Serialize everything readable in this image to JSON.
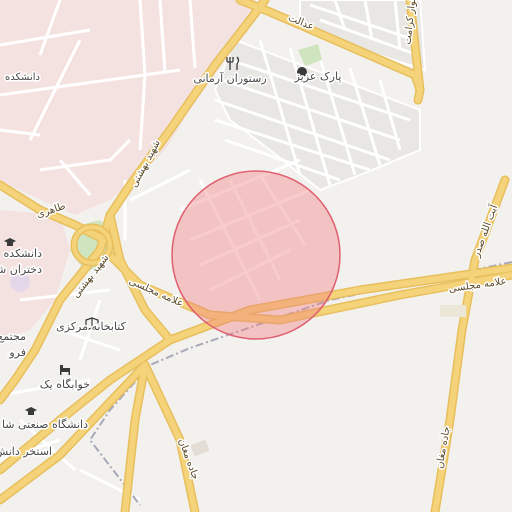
{
  "map": {
    "selection_circle": {
      "fill": "#f08080",
      "stroke": "#e06070"
    },
    "colors": {
      "background": "#f3f1ee",
      "campus": "#f4e2e0",
      "park": "#cfe5bf",
      "major_road": "#f5d37a",
      "major_road_edge": "#e7bf5c",
      "minor_road": "#ffffff",
      "block": "#e8e6e3",
      "railway": "#a8a8b8"
    },
    "labels": {
      "daneshkadeh_top": "دانشکده",
      "restaurant": "رستوران آرمانی",
      "park_aziz": "پارک عزیز",
      "edalat": "عدالت",
      "boulevard_right": "بلوار کرامت",
      "taheri": "طاهری",
      "shahid_beheshti_n": "شهید بهشتی",
      "shahid_beheshti_s": "شهید بهشتی",
      "allameh_majlesi": "علامه مجلسی",
      "majlesi_right": "علامه مجلسی",
      "ayatollah_sadr": "آیت الله صدر",
      "daneshkadeh_dokhtaran_1": "دانشکده",
      "daneshkadeh_dokhtaran_2": "دختران شا",
      "central_library": "کتابخانه مرکزی",
      "mojtama_1": "مجتمع",
      "mojtama_2": "فرو",
      "dormitory": "خوابگاه یک",
      "industrial_univ": "دانشگاه صنعتی شا",
      "pool": "استخر دانش",
      "jadeh_maghan_left": "جاده مغان",
      "jadeh_maghan_right": "جاده مغان"
    },
    "icons": {
      "restaurant": "fork-knife-icon",
      "park": "tree-icon",
      "university": "graduation-cap-icon",
      "library": "book-icon",
      "dormitory": "bed-icon"
    }
  }
}
